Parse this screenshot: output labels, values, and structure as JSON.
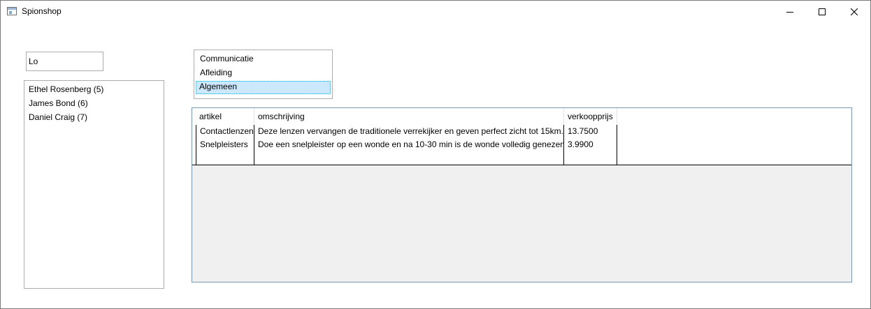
{
  "window": {
    "title": "Spionshop"
  },
  "search": {
    "value": "Lo"
  },
  "agents": {
    "items": [
      "Ethel Rosenberg (5)",
      "James Bond (6)",
      "Daniel Craig (7)"
    ]
  },
  "categories": {
    "items": [
      "Communicatie",
      "Afleiding",
      "Algemeen"
    ],
    "selected": "Algemeen"
  },
  "grid": {
    "columns": [
      "artikel",
      "omschrijving",
      "verkoopprijs"
    ],
    "rows": [
      [
        "Contactlenzen",
        "Deze lenzen vervangen de traditionele verrekijker en geven perfect zicht tot 15km.",
        "13.7500"
      ],
      [
        "Snelpleisters",
        "Doe een snelpleister op een wonde en na 10-30 min is de wonde volledig genezen",
        "3.9900"
      ]
    ]
  },
  "colors": {
    "selection": "#cce8ff",
    "selection_border": "#26a0da",
    "grid_border": "#7a96b3",
    "grid_background": "#f0f0f0"
  }
}
